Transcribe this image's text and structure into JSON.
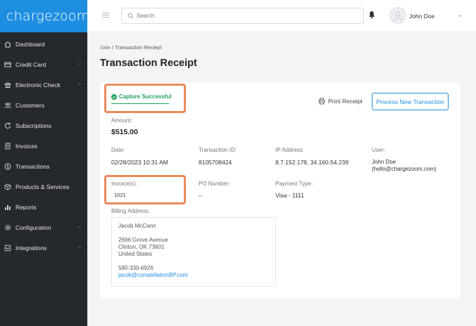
{
  "app": {
    "logo": "chargezoom"
  },
  "sidebar": {
    "items": [
      {
        "label": "Dashboard",
        "icon": "home-icon",
        "has_chevron": false
      },
      {
        "label": "Credit Card",
        "icon": "credit-card-icon",
        "has_chevron": true
      },
      {
        "label": "Electronic Check",
        "icon": "bank-icon",
        "has_chevron": true
      },
      {
        "label": "Customers",
        "icon": "users-icon",
        "has_chevron": false
      },
      {
        "label": "Subscriptions",
        "icon": "refresh-icon",
        "has_chevron": false
      },
      {
        "label": "Invoices",
        "icon": "document-icon",
        "has_chevron": false
      },
      {
        "label": "Transactions",
        "icon": "dollar-circle-icon",
        "has_chevron": false
      },
      {
        "label": "Products & Services",
        "icon": "box-icon",
        "has_chevron": false
      },
      {
        "label": "Reports",
        "icon": "bar-chart-icon",
        "has_chevron": false
      },
      {
        "label": "Configuration",
        "icon": "gear-icon",
        "has_chevron": true
      },
      {
        "label": "Integrations",
        "icon": "plug-icon",
        "has_chevron": true
      }
    ]
  },
  "header": {
    "search_placeholder": "Search",
    "user_name": "John Doe"
  },
  "breadcrumb": {
    "parent": "Sale",
    "separator": " / ",
    "current": "Transaction Reciept"
  },
  "page_title": "Transaction Receipt",
  "receipt": {
    "status": "Capture Successful",
    "print_label": "Print Receipt",
    "new_transaction_label": "Process New Transaction",
    "amount_label": "Amount:",
    "amount_value": "$515.00",
    "date_label": "Date:",
    "date_value": "02/28/2023 10:31 AM",
    "transaction_id_label": "Transaction ID:",
    "transaction_id_value": "8105708424",
    "ip_label": "IP Address:",
    "ip_value": "8.7.152.178, 34.160.54.239",
    "user_label": "User:",
    "user_value_1": "John Doe",
    "user_value_2": "(hello@chargezoom.com)",
    "invoice_label": "Invoice(s):",
    "invoice_value": "1021",
    "po_label": "PO Number:",
    "po_value": "--",
    "payment_label": "Payment Type:",
    "payment_value": "Visa - 1111",
    "billing_label": "Billing Address:",
    "billing": {
      "name": "Jacob McCann",
      "street": "2696 Grove Avenue",
      "city": "Clinton, OK 73601",
      "country": "United States",
      "phone": "580-330-6926",
      "email": "jacob@constellationBP.com"
    }
  },
  "colors": {
    "brand": "#1e8ee0",
    "sidebar": "#25282d",
    "success": "#21a35c",
    "highlight": "#e98a5d"
  }
}
